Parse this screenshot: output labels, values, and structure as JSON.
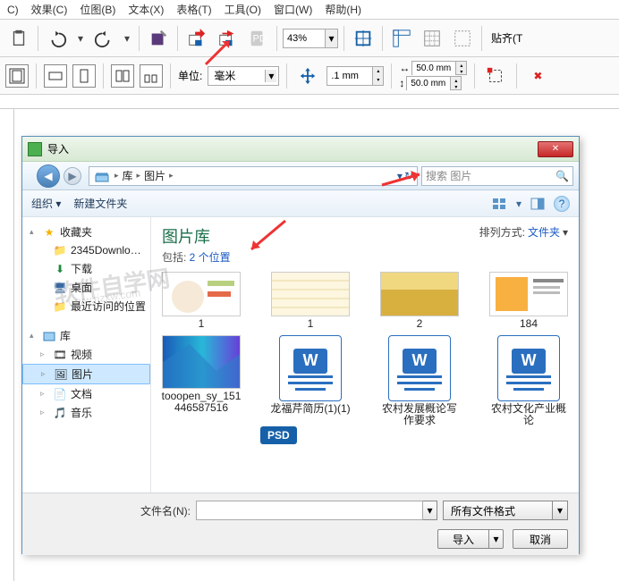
{
  "menu": {
    "items": [
      "效果(C)",
      "位图(B)",
      "文本(X)",
      "表格(T)",
      "工具(O)",
      "窗口(W)",
      "帮助(H)"
    ]
  },
  "toolbar1": {
    "zoom": "43%",
    "snap_label": "贴齐(T"
  },
  "toolbar2": {
    "unit_label": "单位:",
    "unit_value": "毫米",
    "value1": ".1 mm",
    "value2_a": "50.0 mm",
    "value2_b": "50.0 mm"
  },
  "dialog": {
    "title": "导入",
    "breadcrumb": {
      "root": "库",
      "folder": "图片"
    },
    "search_placeholder": "搜索 图片",
    "tb": {
      "org": "组织 ▾",
      "newfolder": "新建文件夹"
    },
    "content": {
      "title": "图片库",
      "sub_prefix": "包括: ",
      "sub_link": "2 个位置",
      "sort_label": "排列方式:",
      "sort_value": "文件夹"
    },
    "tree": {
      "fav": "收藏夹",
      "dl2345": "2345Downlo…",
      "downloads": "下载",
      "desktop": "桌面",
      "recent": "最近访问的位置",
      "libs": "库",
      "video": "视频",
      "pictures": "图片",
      "docs": "文档",
      "music": "音乐"
    },
    "thumbs_row1": [
      {
        "cap": "1"
      },
      {
        "cap": "1"
      },
      {
        "cap": "2"
      },
      {
        "cap": "184"
      }
    ],
    "thumbs_row2": [
      {
        "cap": "tooopen_sy_151446587516"
      },
      {
        "cap": "龙福芹简历(1)(1)"
      },
      {
        "cap": "农村发展概论写作要求"
      },
      {
        "cap": "农村文化产业概论"
      }
    ],
    "psd_badge": "PSD",
    "foot": {
      "fn_label": "文件名(N):",
      "filter": "所有文件格式",
      "import": "导入",
      "cancel": "取消"
    }
  },
  "watermark": {
    "l1": "软件自学网",
    "l2": "www.rjzxw.com"
  }
}
